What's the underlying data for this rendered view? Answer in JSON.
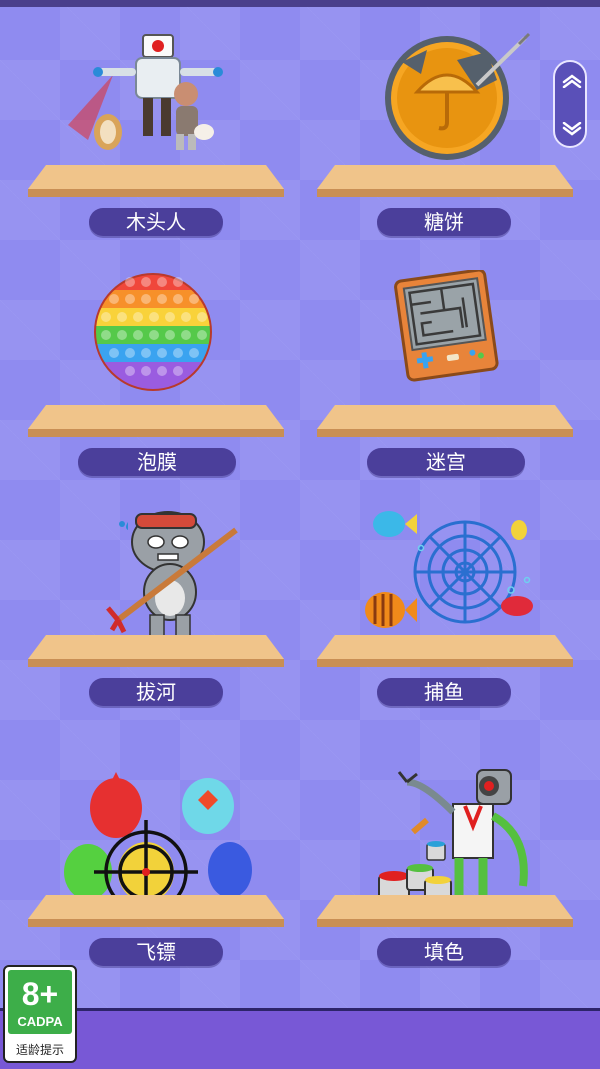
{
  "games": [
    {
      "label": "木头人"
    },
    {
      "label": "糖饼"
    },
    {
      "label": "泡膜"
    },
    {
      "label": "迷宫"
    },
    {
      "label": "拔河"
    },
    {
      "label": "捕鱼"
    },
    {
      "label": "飞镖"
    },
    {
      "label": "填色"
    }
  ],
  "age_rating": {
    "number": "8+",
    "org": "CADPA",
    "hint": "适龄提示"
  },
  "colors": {
    "background": "#8f8bf0",
    "label_bg": "#4b3f9b",
    "shelf": "#f0c48a",
    "bottom_bar": "#7858d6"
  },
  "icons": {
    "scroll_up": "chevron-up-icon",
    "scroll_down": "chevron-down-icon"
  }
}
